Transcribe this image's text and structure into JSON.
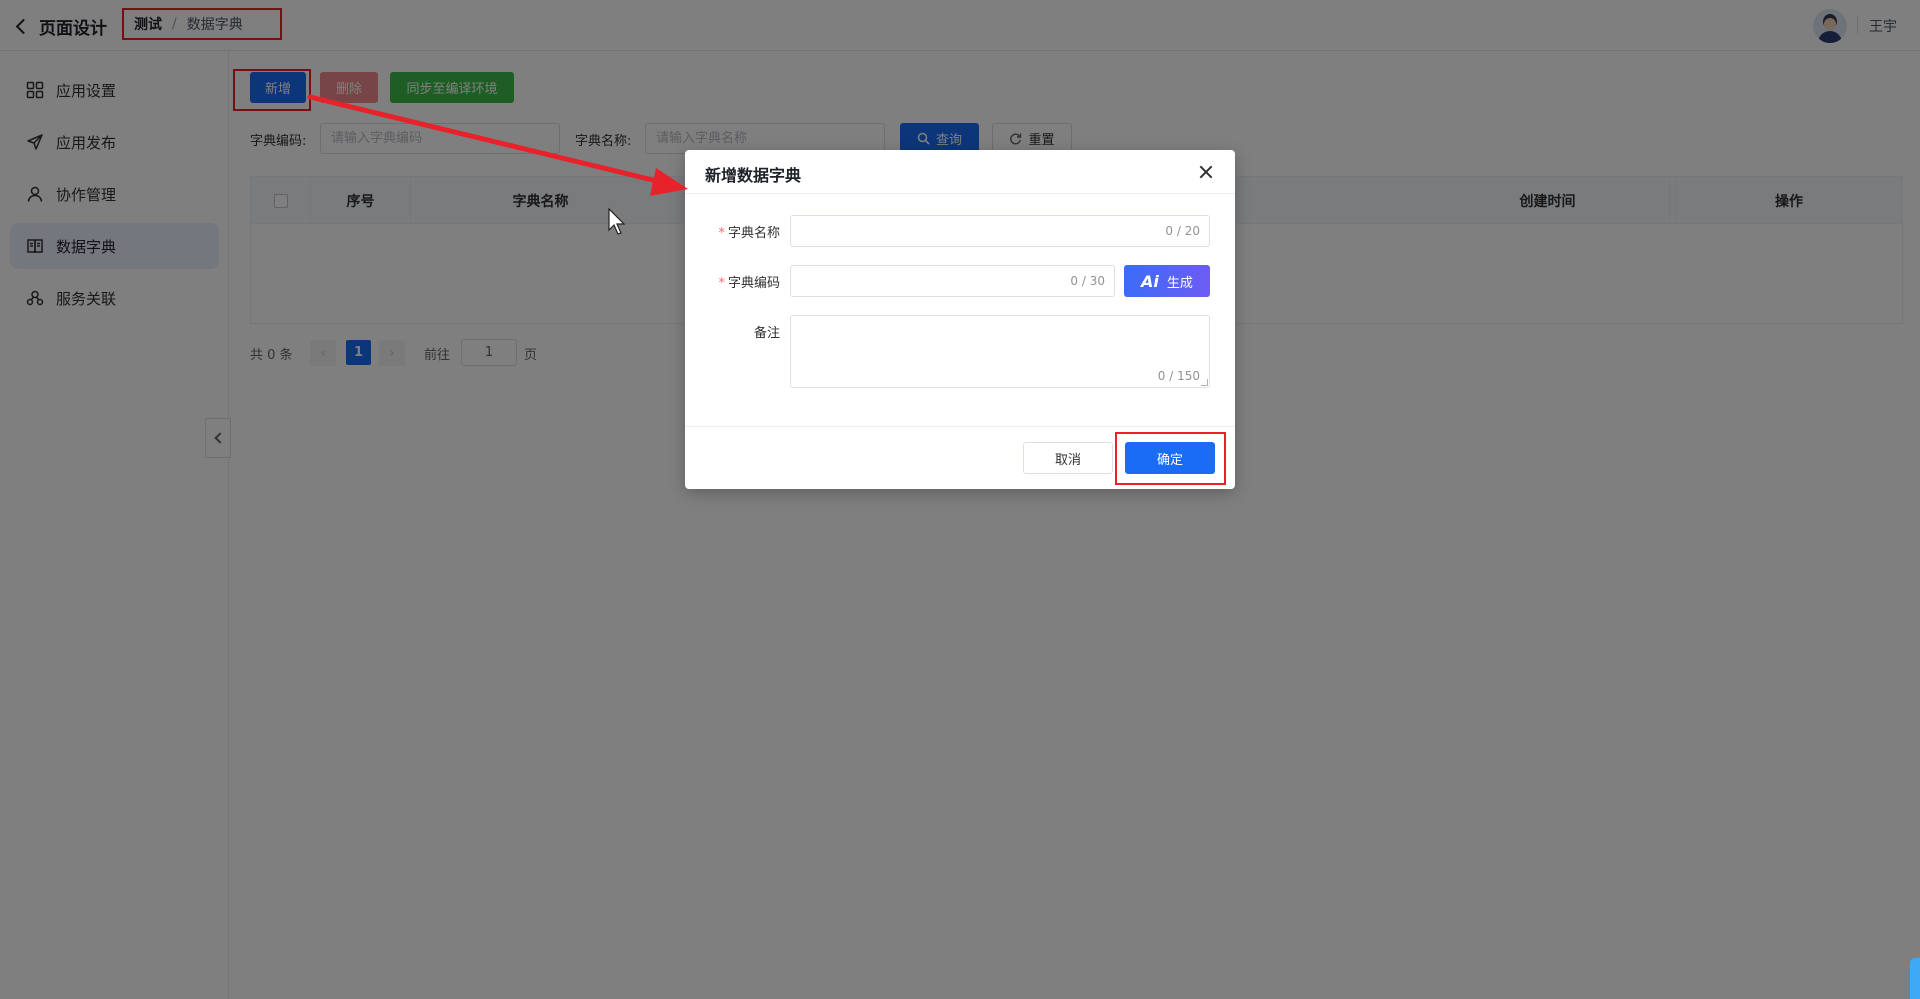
{
  "header": {
    "back_label": "页面设计",
    "breadcrumb": [
      "测试",
      "/",
      "数据字典"
    ],
    "user_name": "王宇"
  },
  "sidebar": {
    "items": [
      {
        "label": "应用设置",
        "icon": "grid-icon",
        "active": false
      },
      {
        "label": "应用发布",
        "icon": "send-icon",
        "active": false
      },
      {
        "label": "协作管理",
        "icon": "user-icon",
        "active": false
      },
      {
        "label": "数据字典",
        "icon": "book-icon",
        "active": true
      },
      {
        "label": "服务关联",
        "icon": "link-icon",
        "active": false
      }
    ]
  },
  "toolbar": {
    "new_label": "新增",
    "delete_label": "删除",
    "sync_label": "同步至编译环境"
  },
  "filters": {
    "code_label": "字典编码:",
    "code_placeholder": "请输入字典编码",
    "name_label": "字典名称:",
    "name_placeholder": "请输入字典名称",
    "query_label": "查询",
    "reset_label": "重置"
  },
  "table": {
    "columns": [
      "序号",
      "字典名称",
      "创建时间",
      "操作"
    ],
    "rows": []
  },
  "pagination": {
    "total_text": "共 0 条",
    "current_page": "1",
    "goto_label": "前往",
    "goto_value": "1",
    "page_suffix": "页"
  },
  "dialog": {
    "title": "新增数据字典",
    "fields": {
      "name_label": "字典名称",
      "name_count": "0 / 20",
      "code_label": "字典编码",
      "code_count": "0 / 30",
      "ai_label": "生成",
      "ai_badge": "Ai",
      "remark_label": "备注",
      "remark_count": "0 / 150",
      "required_mark": "*"
    },
    "cancel_label": "取消",
    "confirm_label": "确定"
  },
  "colors": {
    "primary": "#1a6cf5",
    "danger": "#f08a8c",
    "success": "#3dba46",
    "annotation": "#e8222b"
  }
}
